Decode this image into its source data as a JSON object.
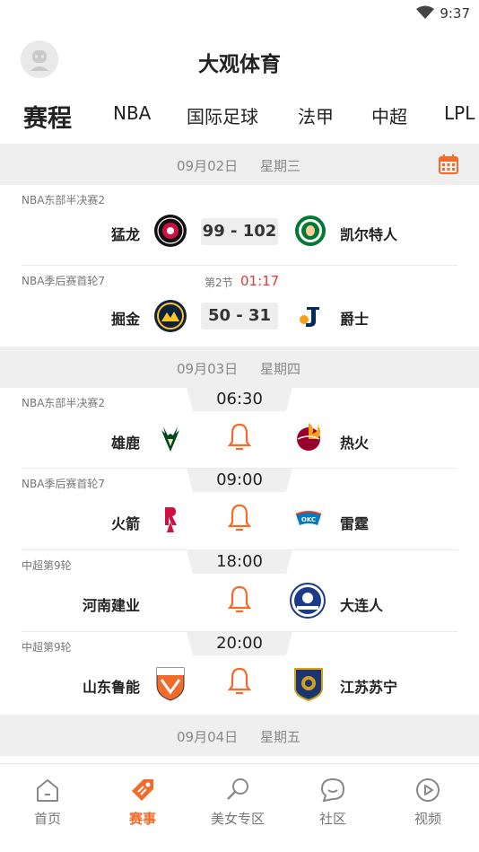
{
  "status_bar": {
    "time": "9:37"
  },
  "header": {
    "title": "大观体育"
  },
  "tabs": [
    {
      "label": "赛程"
    },
    {
      "label": "NBA"
    },
    {
      "label": "国际足球"
    },
    {
      "label": "法甲"
    },
    {
      "label": "中超"
    },
    {
      "label": "LPL"
    }
  ],
  "days": [
    {
      "date": "09月02日",
      "weekday": "星期三",
      "matches": [
        {
          "league": "NBA东部半决赛2",
          "home": "猛龙",
          "away": "凯尔特人",
          "score": "99 - 102"
        },
        {
          "league": "NBA季后赛首轮7",
          "home": "掘金",
          "away": "爵士",
          "score": "50 - 31",
          "period": "第2节",
          "clock": "01:17"
        }
      ]
    },
    {
      "date": "09月03日",
      "weekday": "星期四",
      "matches": [
        {
          "league": "NBA东部半决赛2",
          "home": "雄鹿",
          "away": "热火",
          "time": "06:30"
        },
        {
          "league": "NBA季后赛首轮7",
          "home": "火箭",
          "away": "雷霆",
          "time": "09:00"
        },
        {
          "league": "中超第9轮",
          "home": "河南建业",
          "away": "大连人",
          "time": "18:00"
        },
        {
          "league": "中超第9轮",
          "home": "山东鲁能",
          "away": "江苏苏宁",
          "time": "20:00"
        }
      ]
    },
    {
      "date": "09月04日",
      "weekday": "星期五",
      "matches": []
    }
  ],
  "bottom_nav": [
    {
      "label": "首页",
      "icon": "home-icon"
    },
    {
      "label": "赛事",
      "icon": "tag-icon",
      "active": true
    },
    {
      "label": "美女专区",
      "icon": "search-person-icon"
    },
    {
      "label": "社区",
      "icon": "chat-bubble-icon"
    },
    {
      "label": "视频",
      "icon": "play-icon"
    }
  ],
  "colors": {
    "accent": "#f26b2a",
    "live_clock": "#e53935",
    "date_bar_bg": "#efefef"
  }
}
